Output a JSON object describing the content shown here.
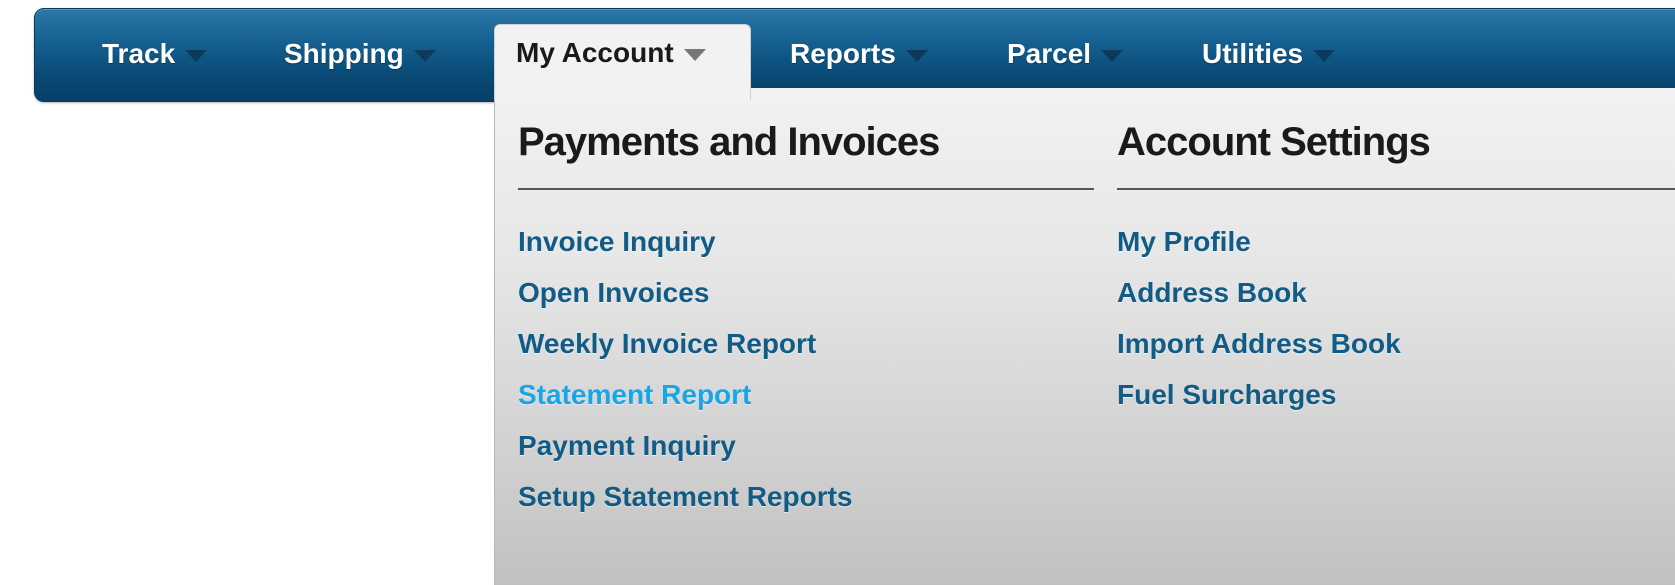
{
  "nav": {
    "items": [
      {
        "label": "Track"
      },
      {
        "label": "Shipping"
      },
      {
        "label": "My Account"
      },
      {
        "label": "Reports"
      },
      {
        "label": "Parcel"
      },
      {
        "label": "Utilities"
      }
    ],
    "active": "My Account"
  },
  "dropdown": {
    "columns": [
      {
        "heading": "Payments and Invoices",
        "links": [
          {
            "label": "Invoice Inquiry"
          },
          {
            "label": "Open Invoices"
          },
          {
            "label": "Weekly Invoice Report"
          },
          {
            "label": "Statement Report"
          },
          {
            "label": "Payment Inquiry"
          },
          {
            "label": "Setup Statement Reports"
          }
        ]
      },
      {
        "heading": "Account Settings",
        "links": [
          {
            "label": "My Profile"
          },
          {
            "label": "Address Book"
          },
          {
            "label": "Import Address Book"
          },
          {
            "label": "Fuel Surcharges"
          }
        ]
      }
    ]
  },
  "colors": {
    "nav_bar": "#0a4b78",
    "link": "#115b87",
    "link_hover": "#19a6e6",
    "dropdown_bg": "#e6e6e6"
  }
}
